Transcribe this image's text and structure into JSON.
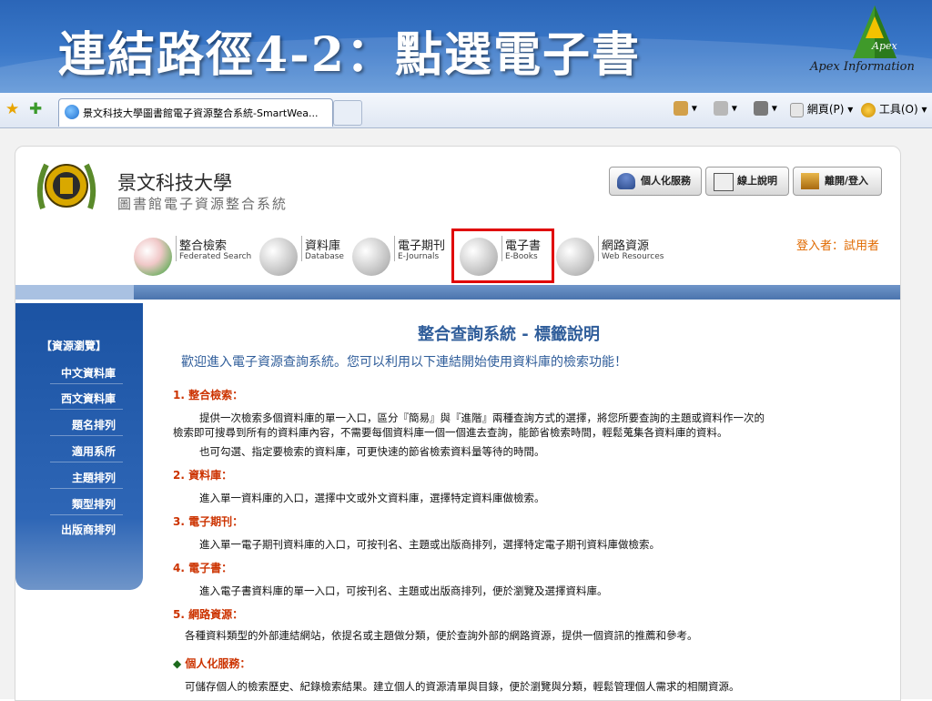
{
  "slide": {
    "title": "連結路徑4-2：點選電子書",
    "logo_apex": "Apex",
    "logo_text": "Apex Information"
  },
  "browser": {
    "tab_title": "景文科技大學圖書館電子資源整合系統-SmartWea...",
    "page_menu": "網頁(P)",
    "tools_menu": "工具(O)"
  },
  "site": {
    "university_name": "景文科技大學",
    "system_name": "圖書館電子資源整合系統",
    "top_buttons": [
      "個人化服務",
      "線上說明",
      "離開/登入"
    ],
    "nav": [
      {
        "zh": "整合檢索",
        "en": "Federated Search"
      },
      {
        "zh": "資料庫",
        "en": "Database"
      },
      {
        "zh": "電子期刊",
        "en": "E-Journals"
      },
      {
        "zh": "電子書",
        "en": "E-Books"
      },
      {
        "zh": "網路資源",
        "en": "Web Resources"
      }
    ],
    "login_user": "登入者：試用者",
    "highlight_color": "#e00000"
  },
  "sidebar": {
    "heading": "【資源瀏覽】",
    "items": [
      "中文資料庫",
      "西文資料庫",
      "題名排列",
      "適用系所",
      "主題排列",
      "類型排列",
      "出版商排列"
    ]
  },
  "content": {
    "title": "整合查詢系統 - 標籤說明",
    "welcome": "歡迎進入電子資源查詢系統。您可以利用以下連結開始使用資料庫的檢索功能！",
    "sections": [
      {
        "head": "1. 整合檢索：",
        "lines": [
          "提供一次檢索多個資料庫的單一入口，區分『簡易』與『進階』兩種查詢方式的選擇，將您所要查詢的主題或資料作一次的",
          "檢索即可搜尋到所有的資料庫內容，不需要每個資料庫一個一個進去查詢，能節省檢索時間，輕鬆蒐集各資料庫的資料。",
          "也可勾選、指定要檢索的資料庫，可更快速的節省檢索資料量等待的時間。"
        ]
      },
      {
        "head": "2. 資料庫：",
        "lines": [
          "進入單一資料庫的入口，選擇中文或外文資料庫，選擇特定資料庫做檢索。"
        ]
      },
      {
        "head": "3. 電子期刊：",
        "lines": [
          "進入單一電子期刊資料庫的入口，可按刊名、主題或出版商排列，選擇特定電子期刊資料庫做檢索。"
        ]
      },
      {
        "head": "4. 電子書：",
        "lines": [
          "進入電子書資料庫的單一入口，可按刊名、主題或出版商排列，便於瀏覽及選擇資料庫。"
        ]
      },
      {
        "head": "5. 網路資源：",
        "lines": [
          "各種資料類型的外部連結網站，依提名或主題做分類，便於查詢外部的網路資源，提供一個資訊的推薦和參考。"
        ]
      }
    ],
    "personal": {
      "head": "個人化服務：",
      "line": "可儲存個人的檢索歷史、紀錄檢索結果。建立個人的資源清單與目錄，便於瀏覽與分類，輕鬆管理個人需求的相關資源。"
    }
  }
}
